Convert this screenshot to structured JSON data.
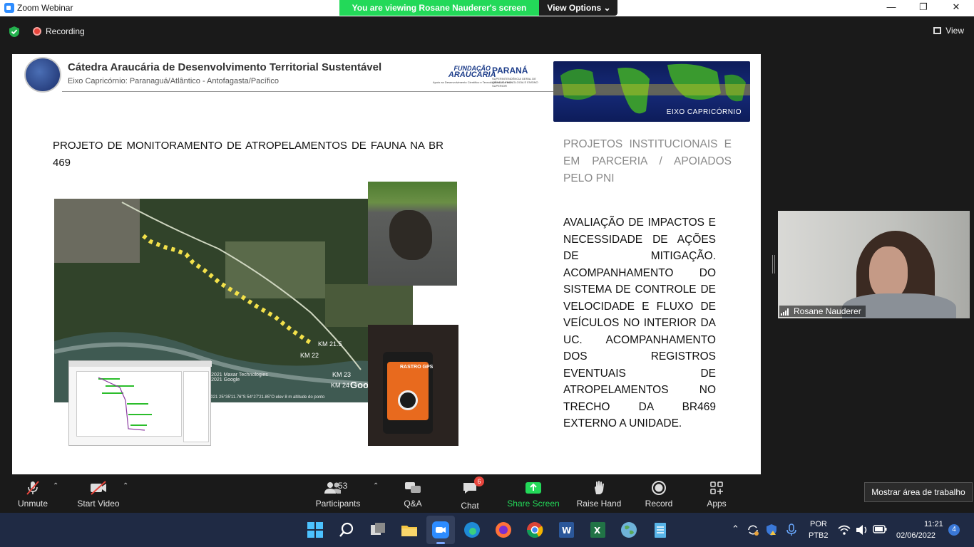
{
  "window": {
    "title": "Zoom Webinar",
    "minimize": "—",
    "maximize": "❐",
    "close": "✕"
  },
  "share_banner": {
    "viewing": "You are viewing Rosane Nauderer's screen",
    "view_options": "View Options ⌄"
  },
  "meeting_bar": {
    "recording": "Recording",
    "view": "View"
  },
  "slide": {
    "title": "Cátedra Araucária de Desenvolvimento Territorial Sustentável",
    "subtitle": "Eixo Capricórnio: Paranaguá/Atlântico - Antofagasta/Pacífico",
    "fundacao": "FUNDAÇÃO",
    "araucaria": "ARAUCÁRIA",
    "fund_tag": "Apoio ao Desenvolvimento Científico e Tecnológico do Paraná",
    "parana": "PARANÁ",
    "parana_tag": "SUPERINTENDÊNCIA GERAL DE CIÊNCIA, TECNOLOGIA E ENSINO SUPERIOR",
    "eixo_label": "EIXO CAPRICÓRNIO",
    "project_title": "PROJETO DE MONITORAMENTO DE ATROPELAMENTOS DE FAUNA NA BR 469",
    "institutional": "PROJETOS INSTITUCIONAIS E EM PARCERIA / APOIADOS PELO PNI",
    "evaluation": "AVALIAÇÃO DE IMPACTOS E NECESSIDADE DE AÇÕES DE MITIGAÇÃO. ACOMPANHAMENTO DO SISTEMA DE CONTROLE DE VELOCIDADE E FLUXO DE VEÍCULOS NO INTERIOR DA UC. ACOMPANHAMENTO DOS REGISTROS EVENTUAIS DE ATROPELAMENTOS NO TRECHO DA BR469 EXTERNO A UNIDADE.",
    "map_credit": "© 2021 Maxar Technologies\n© 2021 Google",
    "map_footer": "imagens: 3/6/2021   25°35'11.76\"S   54°27'21.85\"O   elev   8 m   altitude do ponto",
    "google": "Goo",
    "km_labels": [
      "KM 21.5",
      "KM 22",
      "KM 23",
      "KM 24"
    ],
    "gps_brand": "RASTRO GPS"
  },
  "participant": {
    "name": "Rosane Nauderer"
  },
  "toolbar": {
    "unmute": "Unmute",
    "start_video": "Start Video",
    "participants": "Participants",
    "participants_count": "53",
    "qa": "Q&A",
    "chat": "Chat",
    "chat_badge": "6",
    "share_screen": "Share Screen",
    "raise_hand": "Raise Hand",
    "record": "Record",
    "apps": "Apps",
    "tooltip": "Mostrar área de trabalho"
  },
  "taskbar": {
    "lang_1": "POR",
    "lang_2": "PTB2",
    "time": "11:21",
    "date": "02/06/2022",
    "notifications": "4"
  },
  "colors": {
    "zoom_green": "#23d959",
    "zoom_blue": "#2d8cff",
    "record_red": "#e8453c",
    "taskbar": "#1f2a44"
  }
}
